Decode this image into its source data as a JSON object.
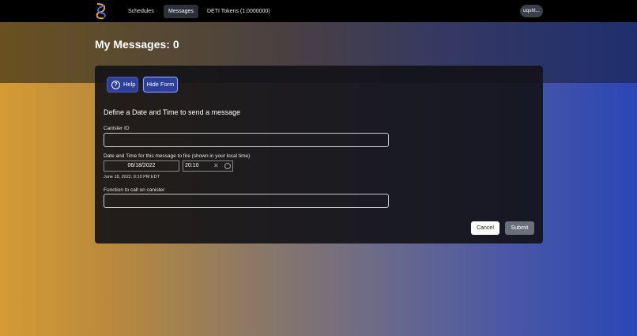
{
  "nav": {
    "items": [
      {
        "label": "Schedules"
      },
      {
        "label": "Messages"
      },
      {
        "label": "DETI Tokens (1.0000000)"
      }
    ],
    "user": "uqshl..."
  },
  "page": {
    "title": "My Messages: 0"
  },
  "toolbar": {
    "help_label": "Help",
    "hide_label": "Hide Form"
  },
  "form": {
    "heading": "Define a Date and Time to send a message",
    "canister_label": "Canister ID",
    "canister_value": "",
    "datetime_label": "Date and Time for this message to fire (shown in your local time)",
    "date_value": "06/18/2022",
    "time_value": "20:10",
    "readout": "June 18, 2022, 8:10 PM EDT",
    "function_label": "Function to call on canister",
    "function_value": "",
    "cancel_label": "Cancel",
    "submit_label": "Submit"
  },
  "colors": {
    "accent": "#2d3e9b",
    "card_bg": "#121216",
    "submit_bg": "#6b6f7c"
  }
}
